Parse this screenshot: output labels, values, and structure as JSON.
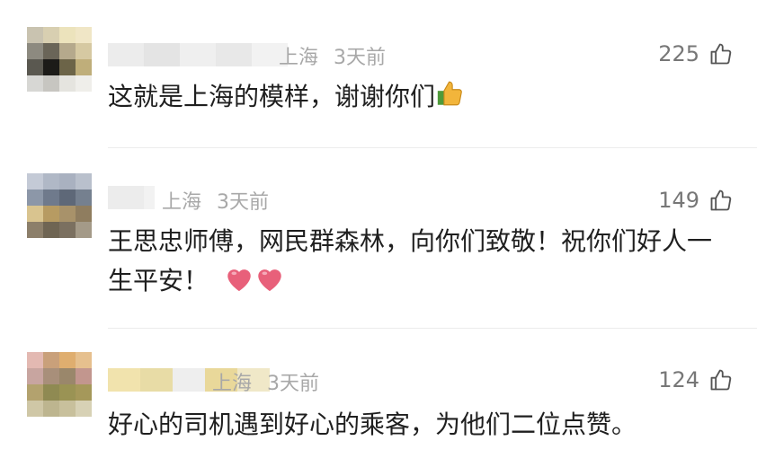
{
  "comments": [
    {
      "location": "上海",
      "time": "3天前",
      "likes": "225",
      "text": "这就是上海的模样，谢谢你们",
      "emoji_names": [
        "thumbs-up-emoji"
      ]
    },
    {
      "location": "上海",
      "time": "3天前",
      "likes": "149",
      "text": "王思忠师傅，网民群森林，向你们致敬！祝你们好人一生平安！",
      "emoji_names": [
        "heart-emoji",
        "heart-emoji"
      ]
    },
    {
      "location": "上海",
      "time": "3天前",
      "likes": "124",
      "text": "好心的司机遇到好心的乘客，为他们二位点赞。",
      "emoji_names": []
    }
  ],
  "colors": {
    "meta_text": "#a8a8a8",
    "body_text": "#1f1f1f",
    "divider": "#ececec",
    "heart": "#e8607a",
    "thumb": "#f2b53b"
  }
}
